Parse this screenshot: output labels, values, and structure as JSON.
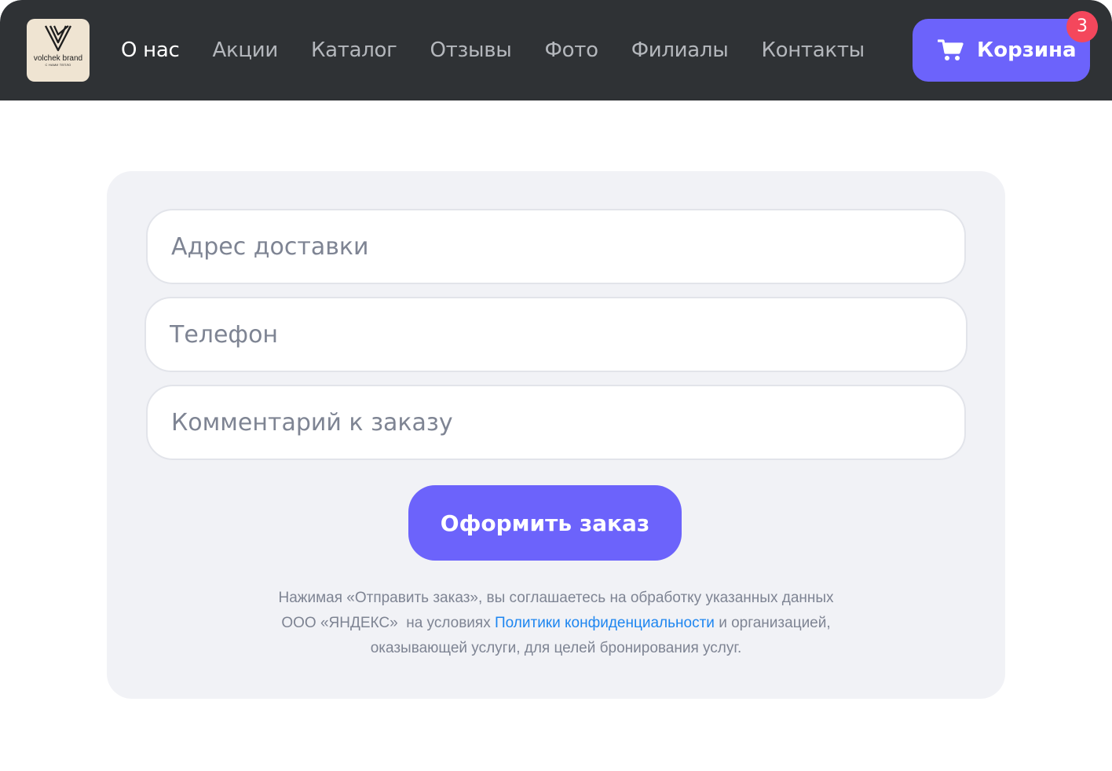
{
  "brand": {
    "name": "volchek brand",
    "tagline": "С НАМИ ТЕПЛО",
    "logo_bg": "#efe4d2"
  },
  "nav": {
    "items": [
      {
        "label": "О нас",
        "active": true
      },
      {
        "label": "Акции"
      },
      {
        "label": "Каталог"
      },
      {
        "label": "Отзывы"
      },
      {
        "label": "Фото"
      },
      {
        "label": "Филиалы"
      },
      {
        "label": "Контакты"
      }
    ]
  },
  "cart": {
    "label": "Корзина",
    "count": "3",
    "icon": "cart-icon"
  },
  "form": {
    "address_placeholder": "Адрес доставки",
    "phone_placeholder": "Телефон",
    "comment_placeholder": "Комментарий к заказу",
    "submit_label": "Оформить заказ"
  },
  "disclaimer": {
    "line1": "Нажимая «Отправить заказ», вы соглашаетесь на обработку указанных данных",
    "line2_prefix": "ООО «ЯНДЕКС»  на условиях ",
    "policy_link": "Политики конфиденциальности",
    "line2_suffix": " и организацией,",
    "line3": "оказывающей услуги, для целей бронирования услуг."
  },
  "colors": {
    "header_bg": "#2f3235",
    "accent": "#6c63fb",
    "badge": "#f4475c",
    "card_bg": "#f1f2f6",
    "link": "#1e86f0"
  }
}
